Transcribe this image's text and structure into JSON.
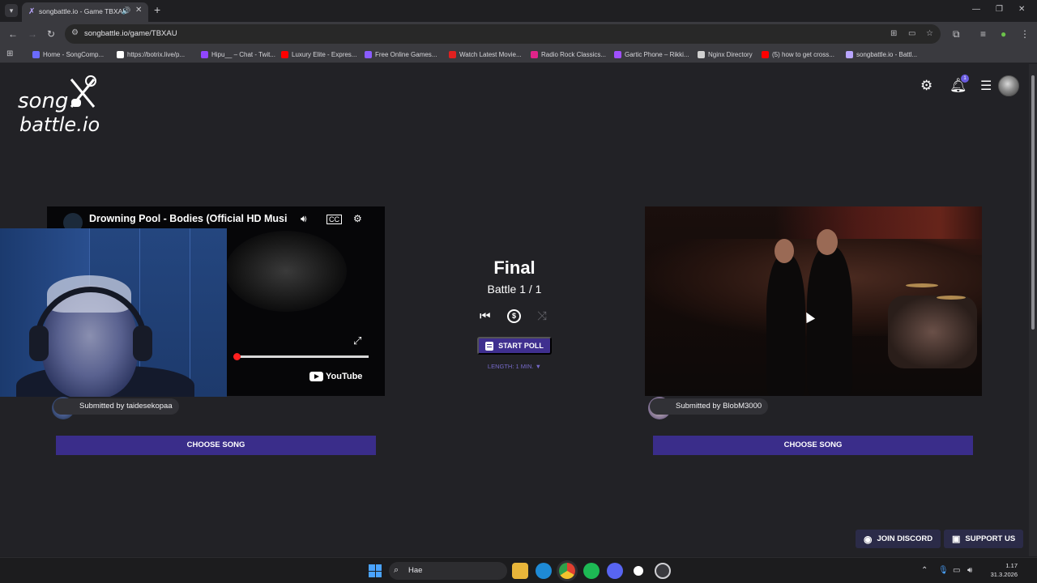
{
  "browser": {
    "tab_title": "songbattle.io - Game TBXAU",
    "url": "songbattle.io/game/TBXAU",
    "bookmarks": [
      {
        "label": "Home - SongComp...",
        "color": "#6b6bff"
      },
      {
        "label": "https://botrix.live/p...",
        "color": "#ffffff"
      },
      {
        "label": "Hipu__ – Chat - Twit...",
        "color": "#9146ff"
      },
      {
        "label": "Luxury Elite - Expres...",
        "color": "#ff0000"
      },
      {
        "label": "Free Online Games...",
        "color": "#8a5cff"
      },
      {
        "label": "Watch Latest Movie...",
        "color": "#e02020"
      },
      {
        "label": "Radio Rock Classics...",
        "color": "#e0248a"
      },
      {
        "label": "Gartic Phone – Rikki...",
        "color": "#a050ff"
      },
      {
        "label": "Nginx Directory",
        "color": "#d0d0d0"
      },
      {
        "label": "(5) how to get cross...",
        "color": "#ff0000"
      },
      {
        "label": "songbattle.io - Battl...",
        "color": "#b9a6ff"
      }
    ]
  },
  "header": {
    "logo_song": "song",
    "logo_battle": "battle.io",
    "notification_count": "1"
  },
  "game": {
    "round_title": "Final",
    "battle_count": "Battle 1 / 1",
    "start_poll_label": "START POLL",
    "length_label": "LENGTH: 1 MIN. ▼"
  },
  "left": {
    "video_title": "Drowning Pool - Bodies (Official HD Musi",
    "youtube_label": "YouTube",
    "progress": 0.0,
    "submitter": "Submitted by taidesekopaa",
    "choose_label": "CHOOSE SONG"
  },
  "right": {
    "submitter": "Submitted by BlobM3000",
    "choose_label": "CHOOSE SONG"
  },
  "footer": {
    "discord_label": "JOIN DISCORD",
    "support_label": "SUPPORT US"
  },
  "taskbar": {
    "search_placeholder": "Hae",
    "time": "1.17",
    "date": "31.3.2026"
  },
  "colors": {
    "accent": "#3a2d8a",
    "page_bg": "#222226",
    "youtube_red": "#ff2020"
  }
}
